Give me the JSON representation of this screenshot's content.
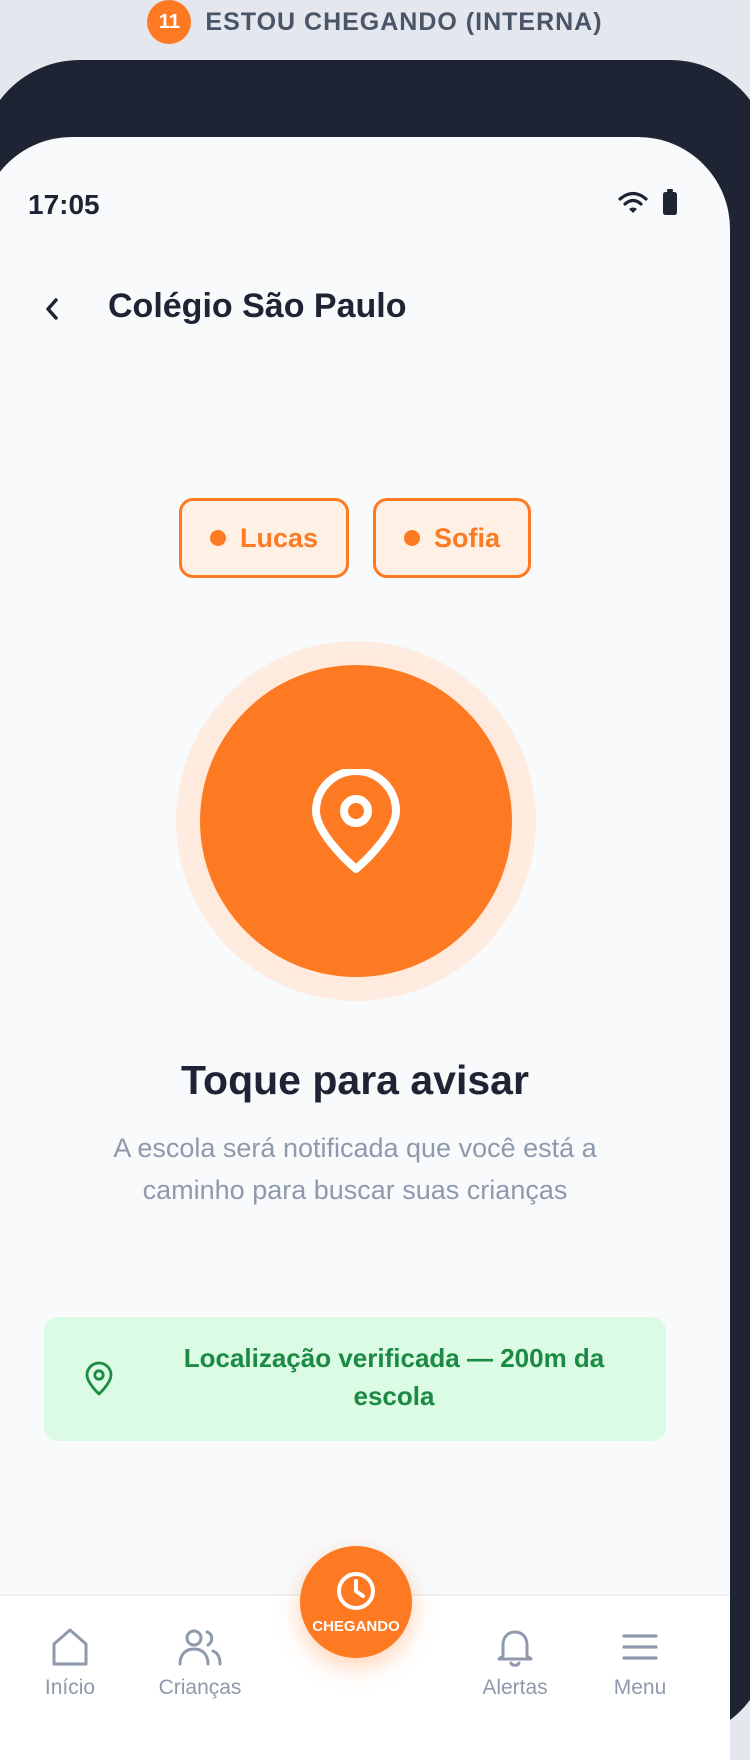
{
  "banner": {
    "step": "11",
    "title": "ESTOU CHEGANDO (INTERNA)"
  },
  "status": {
    "time": "17:05"
  },
  "header": {
    "title": "Colégio São Paulo"
  },
  "children": [
    "Lucas",
    "Sofia"
  ],
  "main": {
    "title": "Toque para avisar",
    "description": "A escola será notificada que você está a caminho para buscar suas crianças",
    "location": "Localização verificada — 200m da escola"
  },
  "nav": {
    "home": "Início",
    "kids": "Crianças",
    "fab": "CHEGANDO",
    "alerts": "Alertas",
    "menu": "Menu"
  },
  "colors": {
    "accent": "#fe7a22",
    "success": "#1b8a43",
    "success_bg": "#dbfbe4",
    "text": "#1e2433",
    "muted": "#8e9aab"
  }
}
